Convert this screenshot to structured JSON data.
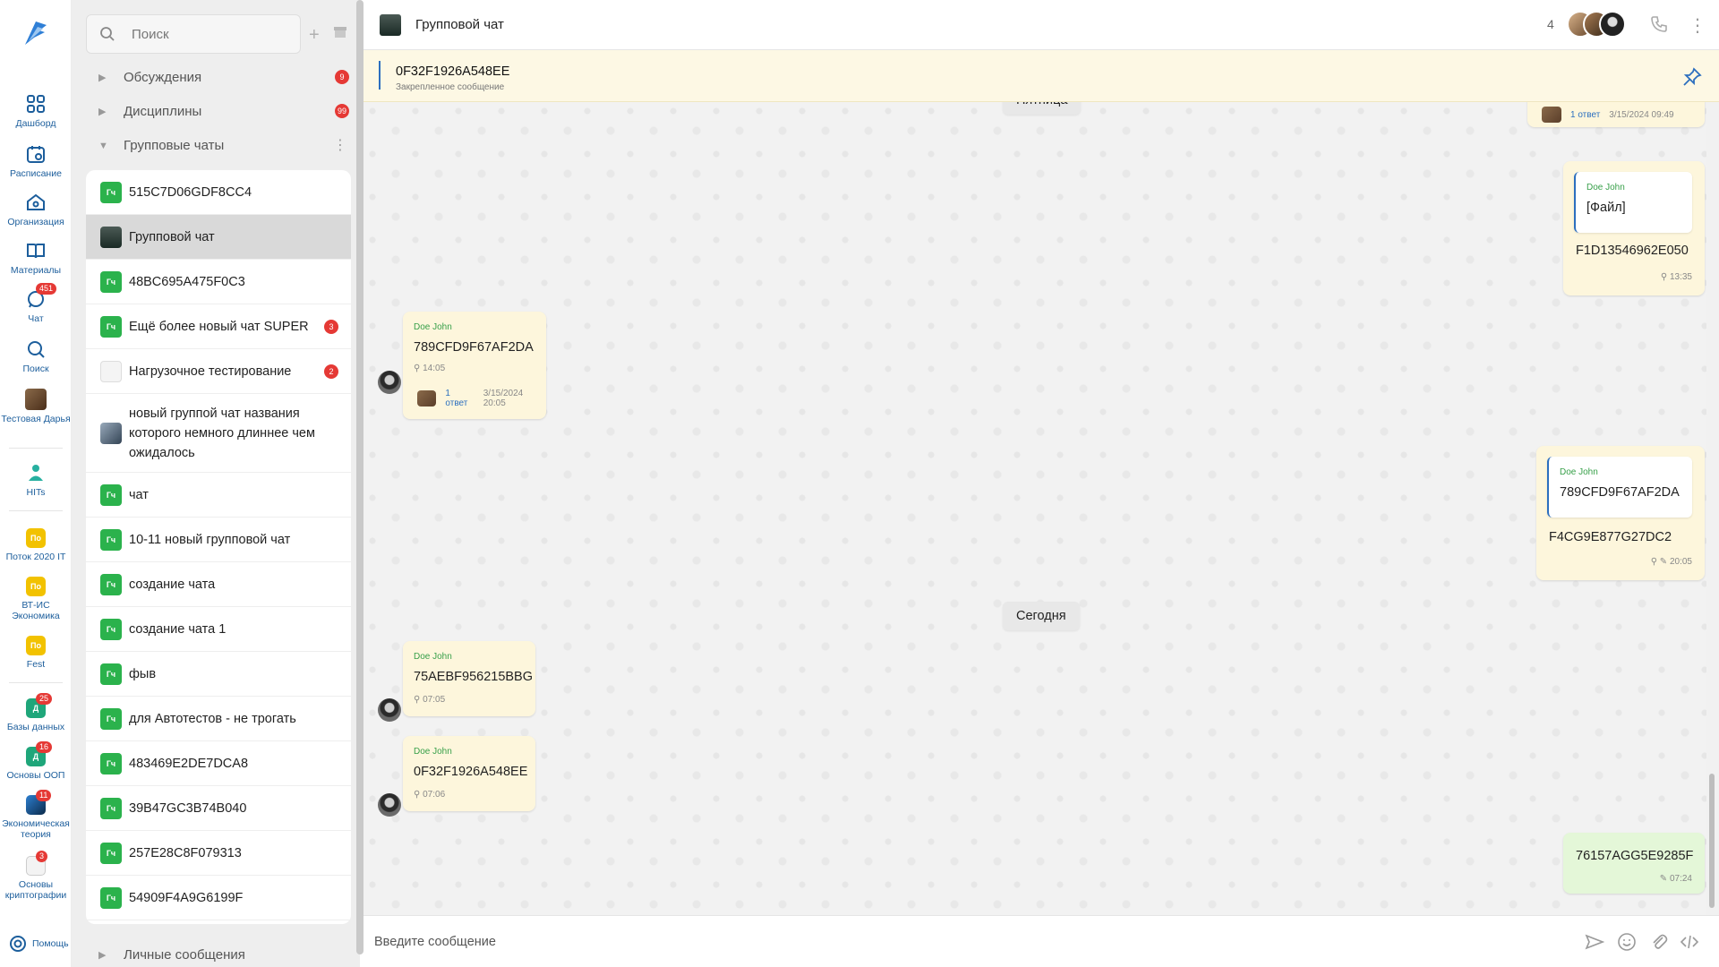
{
  "rail": {
    "items": [
      {
        "label": "Дашборд",
        "icon": "dashboard-icon"
      },
      {
        "label": "Расписание",
        "icon": "calendar-icon"
      },
      {
        "label": "Организация",
        "icon": "home-icon"
      },
      {
        "label": "Материалы",
        "icon": "book-icon"
      },
      {
        "label": "Чат",
        "icon": "chat-icon",
        "badge": "451"
      },
      {
        "label": "Поиск",
        "icon": "search-icon"
      },
      {
        "label": "Тестовая Дарья",
        "icon": "avatar-icon"
      },
      {
        "label": "HITs",
        "icon": "hits-icon"
      }
    ],
    "groups": [
      {
        "label": "Поток 2020 IT",
        "abbr": "По",
        "color": "#f2c200"
      },
      {
        "label": "ВТ-ИС Экономика",
        "abbr": "По",
        "color": "#f2c200"
      },
      {
        "label": "Fest",
        "abbr": "По",
        "color": "#f2c200"
      }
    ],
    "courses": [
      {
        "label": "Базы данных",
        "abbr": "Д",
        "color": "#1fa67a",
        "badge": "25"
      },
      {
        "label": "Основы ООП",
        "abbr": "Д",
        "color": "#1fa67a",
        "badge": "16"
      },
      {
        "label": "Экономическая теория",
        "abbr": "",
        "color": "#2d7fd0",
        "badge": "11"
      },
      {
        "label": "Основы криптографии",
        "abbr": "",
        "color": "#777777",
        "badge": "3"
      }
    ],
    "help": "Помощь"
  },
  "panel": {
    "search_placeholder": "Поиск",
    "sections": [
      {
        "label": "Обсуждения",
        "count": "9"
      },
      {
        "label": "Дисциплины",
        "count": "99"
      },
      {
        "label": "Групповые чаты",
        "count": ""
      }
    ],
    "chats": [
      {
        "name": "515C7D06GDF8CC4",
        "abbr": "Гч",
        "badge": ""
      },
      {
        "name": "Групповой чат",
        "abbr": "",
        "badge": ""
      },
      {
        "name": "48BC695A475F0C3",
        "abbr": "Гч",
        "badge": ""
      },
      {
        "name": "Ещё более новый чат SUPER",
        "abbr": "Гч",
        "badge": "3"
      },
      {
        "name": "Нагрузочное тестирование",
        "abbr": "",
        "badge": "2"
      },
      {
        "name": "новый групп­ой чат названия которого немного длиннее чем ожидалось",
        "abbr": "",
        "badge": ""
      },
      {
        "name": "чат",
        "abbr": "Гч",
        "badge": ""
      },
      {
        "name": "10-11 новый групповой чат",
        "abbr": "Гч",
        "badge": ""
      },
      {
        "name": "создание чата",
        "abbr": "Гч",
        "badge": ""
      },
      {
        "name": "создание чата 1",
        "abbr": "Гч",
        "badge": ""
      },
      {
        "name": "фыв",
        "abbr": "Гч",
        "badge": ""
      },
      {
        "name": "для Автотестов - не трогать",
        "abbr": "Гч",
        "badge": ""
      },
      {
        "name": "483469E2DE7DCA8",
        "abbr": "Гч",
        "badge": ""
      },
      {
        "name": "39B47GC3B74B040",
        "abbr": "Гч",
        "badge": ""
      },
      {
        "name": "257E28C8F079313",
        "abbr": "Гч",
        "badge": ""
      },
      {
        "name": "54909F4A9G6199F",
        "abbr": "Гч",
        "badge": ""
      }
    ],
    "dm_label": "Личные сообщения"
  },
  "header": {
    "title": "Групповой чат",
    "member_count": "4"
  },
  "pinned": {
    "text": "0F32F1926A548EE",
    "subtitle": "Закрепленное сообщение"
  },
  "messages": {
    "top_thread": {
      "replies": "1 ответ",
      "date": "3/15/2024 09:49"
    },
    "day_friday": "Пятница",
    "m1": {
      "quote_author": "Doe John",
      "quote_text": "[Файл]",
      "text": "F1D13546962E050",
      "time": "13:35"
    },
    "m2": {
      "author": "Doe John",
      "text": "789CFD9F67AF2DA",
      "time": "14:05",
      "replies": "1 ответ",
      "date": "3/15/2024 20:05"
    },
    "m3": {
      "quote_author": "Doe John",
      "quote_text": "789CFD9F67AF2DA",
      "text": "F4CG9E877G27DC2",
      "time": "20:05"
    },
    "day_today": "Сегодня",
    "m4": {
      "author": "Doe John",
      "text": "75AEBF956215BBG",
      "time": "07:05"
    },
    "m5": {
      "author": "Doe John",
      "text": "0F32F1926A548EE",
      "time": "07:06"
    },
    "m6": {
      "text": "76157AGG5E9285F",
      "time": "07:24"
    }
  },
  "composer": {
    "placeholder": "Введите сообщение"
  }
}
